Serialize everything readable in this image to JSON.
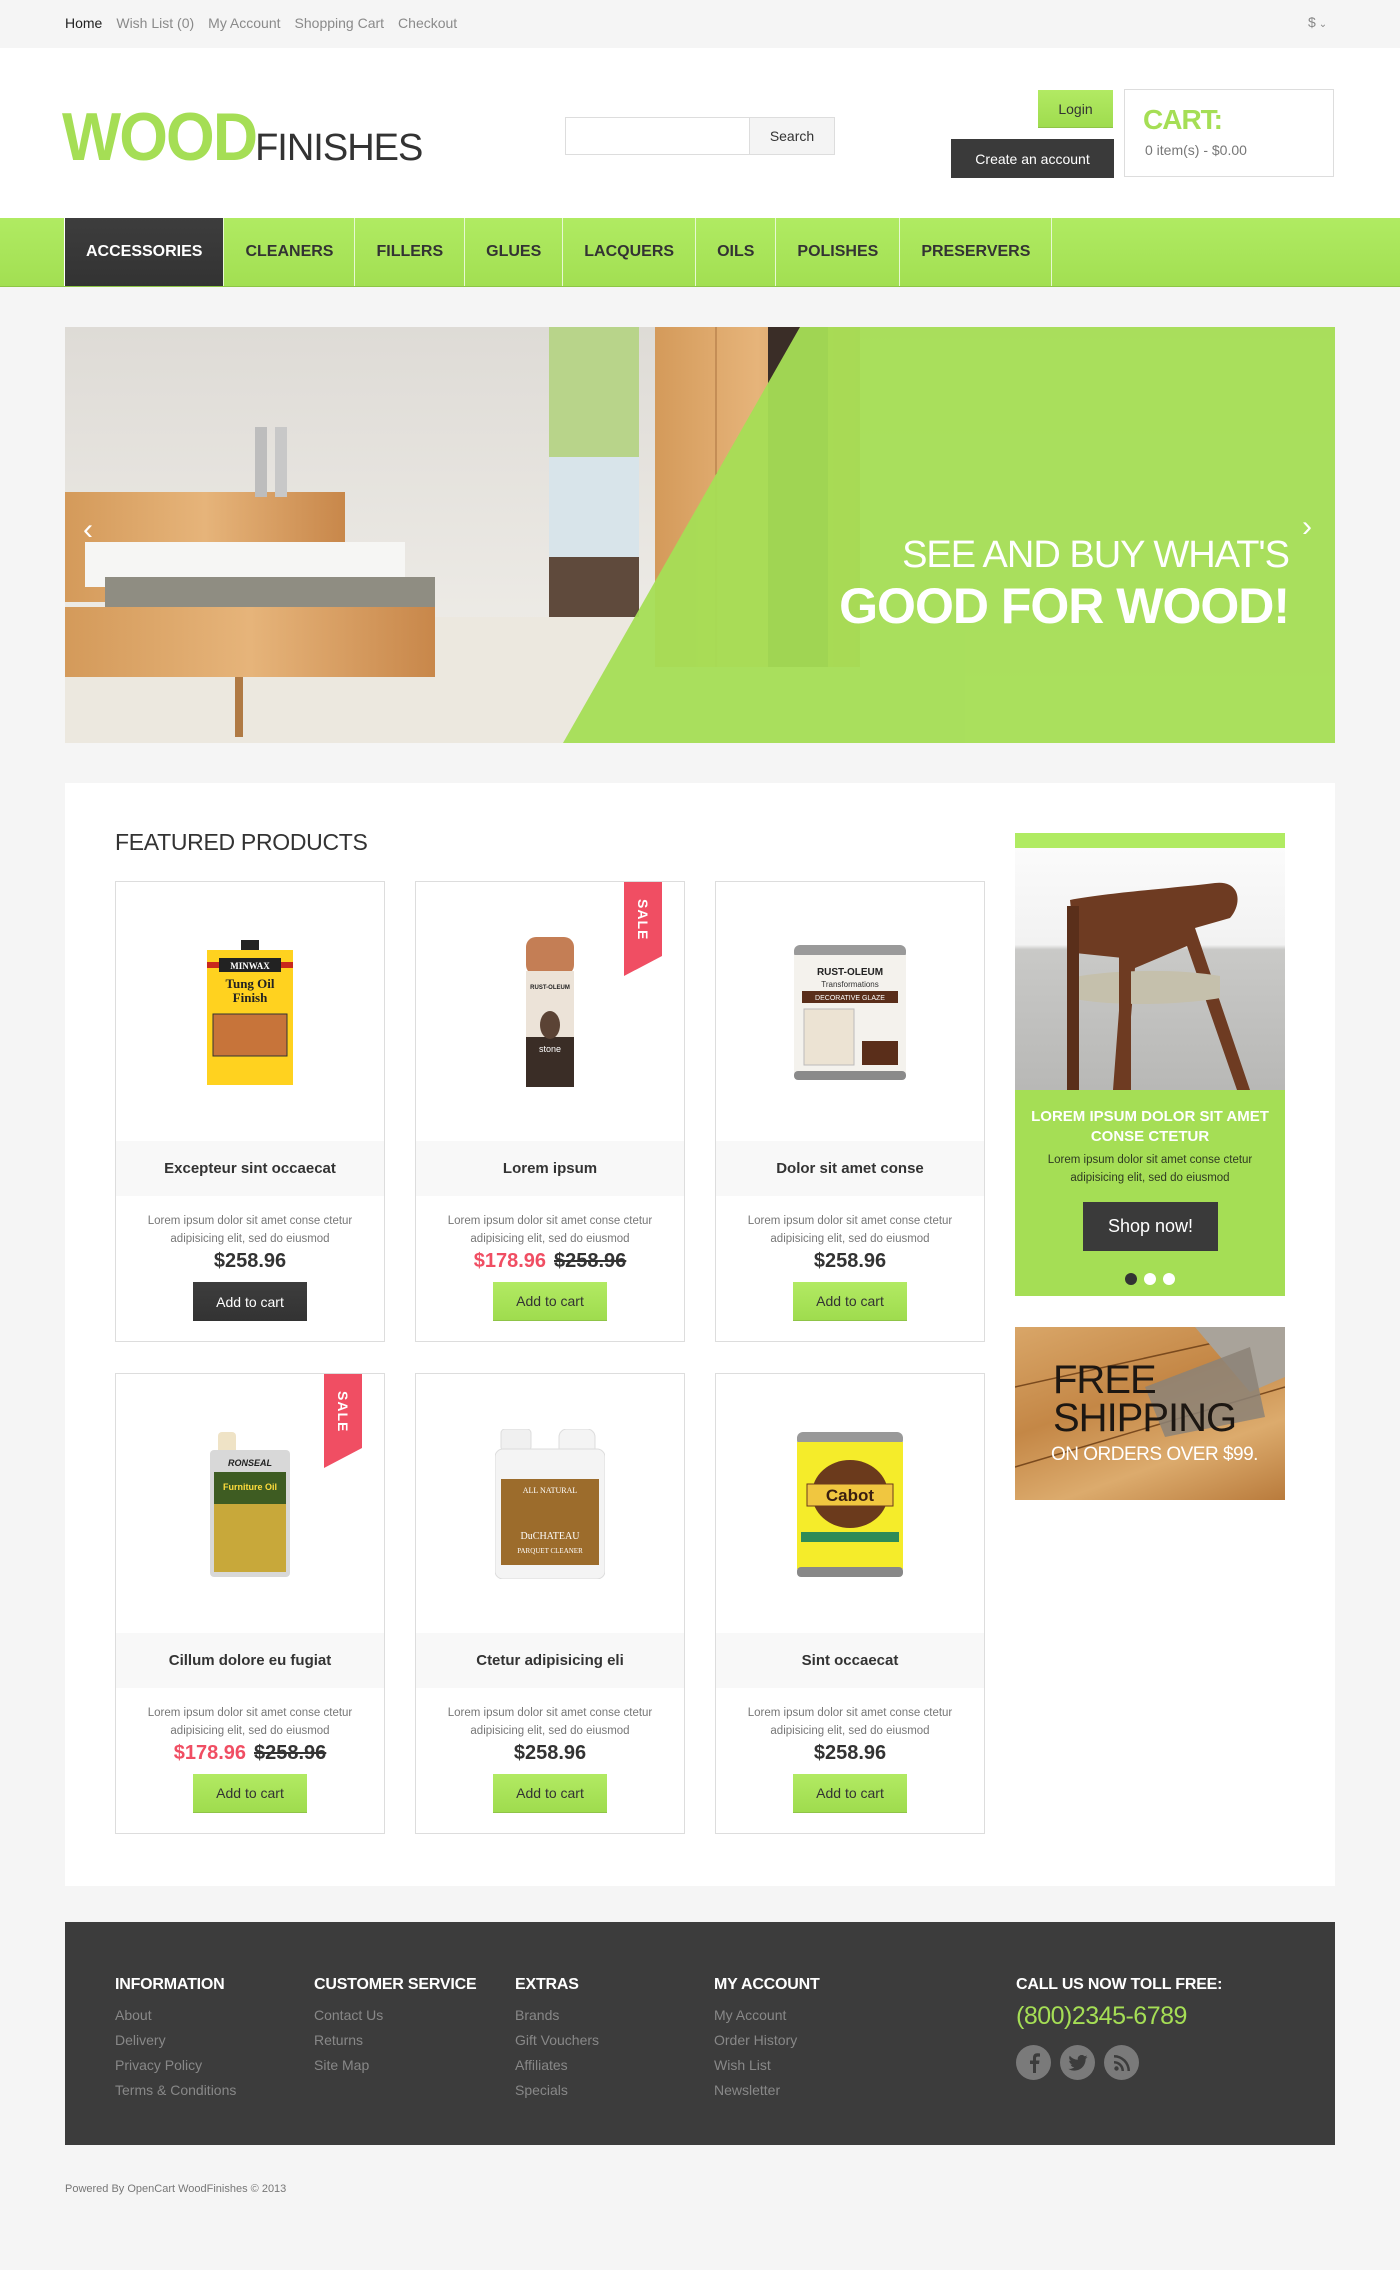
{
  "topbar": {
    "links": [
      {
        "label": "Home",
        "active": true
      },
      {
        "label": "Wish List (0)",
        "active": false
      },
      {
        "label": "My Account",
        "active": false
      },
      {
        "label": "Shopping Cart",
        "active": false
      },
      {
        "label": "Checkout",
        "active": false
      }
    ],
    "currency": "$"
  },
  "header": {
    "logo_bold": "WOOD",
    "logo_light": "FINISHES",
    "search": {
      "value": "",
      "placeholder": "",
      "button_label": "Search"
    },
    "login_label": "Login",
    "create_account_label": "Create an account",
    "cart": {
      "title": "CART:",
      "summary": "0 item(s) - $0.00"
    }
  },
  "nav": {
    "items": [
      {
        "label": "ACCESSORIES",
        "active": true
      },
      {
        "label": "CLEANERS",
        "active": false
      },
      {
        "label": "FILLERS",
        "active": false
      },
      {
        "label": "GLUES",
        "active": false
      },
      {
        "label": "LACQUERS",
        "active": false
      },
      {
        "label": "OILS",
        "active": false
      },
      {
        "label": "POLISHES",
        "active": false
      },
      {
        "label": "PRESERVERS",
        "active": false
      }
    ]
  },
  "banner": {
    "line1": "SEE AND BUY WHAT'S",
    "line2": "GOOD FOR WOOD!",
    "prev_icon": "chevron-left-icon",
    "next_icon": "chevron-right-icon",
    "accent": "#a5de55"
  },
  "featured": {
    "title": "FEATURED PRODUCTS",
    "products": [
      {
        "name": "Excepteur sint occaecat",
        "image": "Minwax Tung Oil Finish can",
        "desc": "Lorem ipsum dolor sit amet conse ctetur adipisicing elit, sed do eiusmod",
        "price": "$258.96",
        "old_price": null,
        "sale": false,
        "button": "Add to cart",
        "button_style": "dark"
      },
      {
        "name": "Lorem ipsum",
        "image": "Rust-Oleum American Accents stone spray can",
        "desc": "Lorem ipsum dolor sit amet conse ctetur adipisicing elit, sed do eiusmod",
        "price": "$178.96",
        "old_price": "$258.96",
        "sale": true,
        "button": "Add to cart",
        "button_style": "green"
      },
      {
        "name": "Dolor sit amet conse",
        "image": "Rust-Oleum Transformations Decorative Glaze can",
        "desc": "Lorem ipsum dolor sit amet conse ctetur adipisicing elit, sed do eiusmod",
        "price": "$258.96",
        "old_price": null,
        "sale": false,
        "button": "Add to cart",
        "button_style": "green"
      },
      {
        "name": "Cillum dolore eu fugiat",
        "image": "Ronseal Furniture Oil tin",
        "desc": "Lorem ipsum dolor sit amet conse ctetur adipisicing elit, sed do eiusmod",
        "price": "$178.96",
        "old_price": "$258.96",
        "sale": true,
        "button": "Add to cart",
        "button_style": "green"
      },
      {
        "name": "Ctetur adipisicing eli",
        "image": "DuChateau Parquet Cleaner jug",
        "desc": "Lorem ipsum dolor sit amet conse ctetur adipisicing elit, sed do eiusmod",
        "price": "$258.96",
        "old_price": null,
        "sale": false,
        "button": "Add to cart",
        "button_style": "green"
      },
      {
        "name": "Sint occaecat",
        "image": "Cabot Decking Stain can",
        "desc": "Lorem ipsum dolor sit amet conse ctetur adipisicing elit, sed do eiusmod",
        "price": "$258.96",
        "old_price": null,
        "sale": false,
        "button": "Add to cart",
        "button_style": "green"
      }
    ],
    "sale_label": "SALE",
    "sale_color": "#f04e63"
  },
  "promo": {
    "title": "LOREM IPSUM DOLOR SIT AMET CONSE CTETUR",
    "text": "Lorem ipsum dolor sit amet conse ctetur adipisicing elit, sed do eiusmod",
    "button": "Shop now!",
    "slides": 3,
    "active_slide": 1
  },
  "shipping": {
    "line1": "FREE",
    "line2": "SHIPPING",
    "line3": "ON ORDERS OVER $99."
  },
  "footer": {
    "columns": [
      {
        "title": "INFORMATION",
        "links": [
          "About",
          "Delivery",
          "Privacy Policy",
          "Terms & Conditions"
        ]
      },
      {
        "title": "CUSTOMER SERVICE",
        "links": [
          "Contact Us",
          "Returns",
          "Site Map"
        ]
      },
      {
        "title": "EXTRAS",
        "links": [
          "Brands",
          "Gift Vouchers",
          "Affiliates",
          "Specials"
        ]
      },
      {
        "title": "MY ACCOUNT",
        "links": [
          "My Account",
          "Order History",
          "Wish List",
          "Newsletter"
        ]
      }
    ],
    "call_title": "CALL US NOW TOLL FREE:",
    "phone": "(800)2345-6789",
    "social": [
      {
        "name": "facebook-icon",
        "glyph": "f"
      },
      {
        "name": "twitter-icon",
        "glyph": "t"
      },
      {
        "name": "rss-icon",
        "glyph": "rss"
      }
    ]
  },
  "copyright": "Powered By OpenCart WoodFinishes © 2013"
}
